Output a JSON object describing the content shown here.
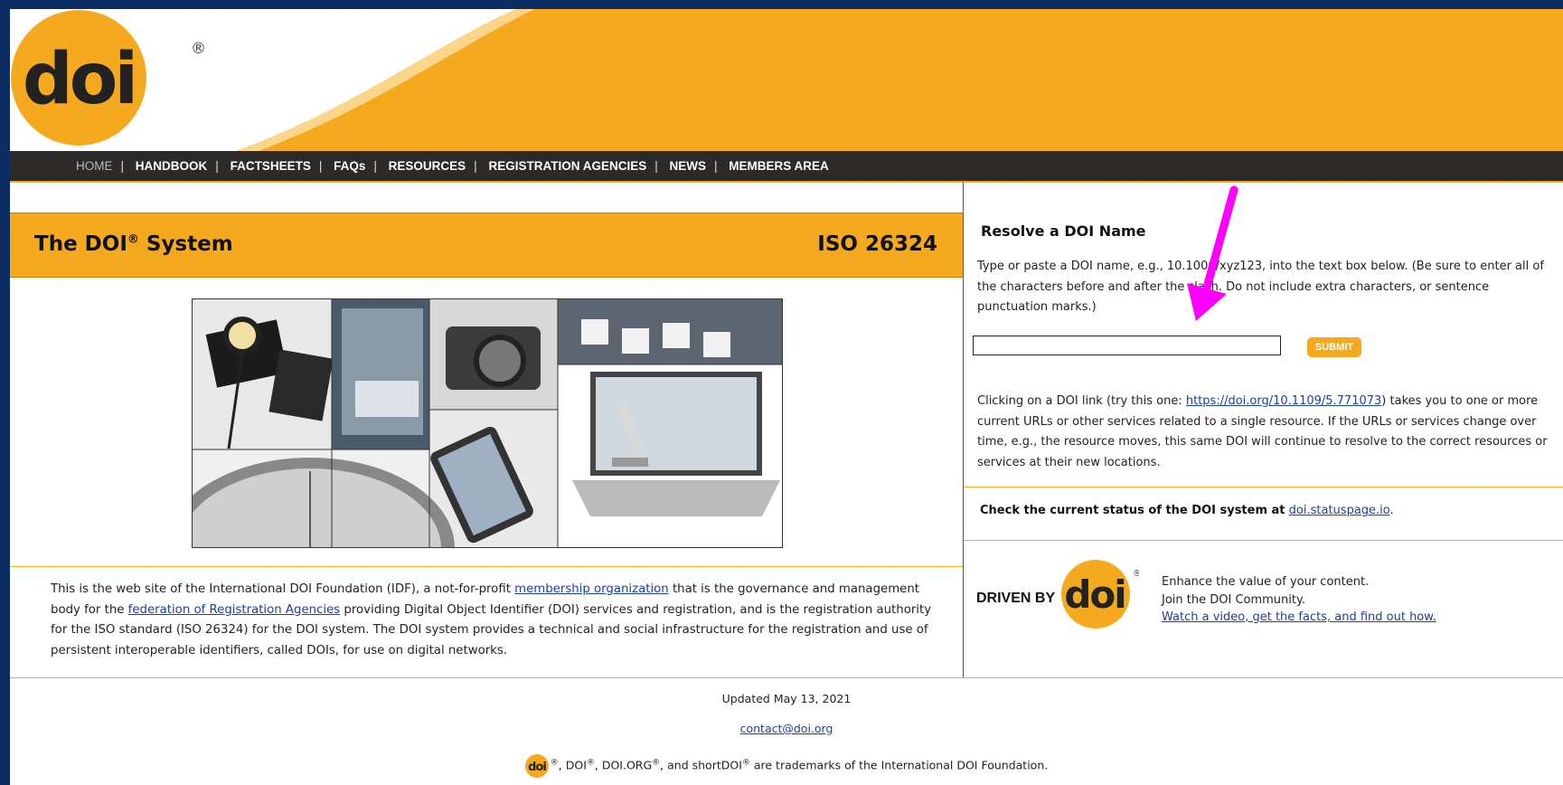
{
  "brand": {
    "logo_text": "doi",
    "registered": "®",
    "driven_by": "DRIVEN BY"
  },
  "colors": {
    "orange": "#f5a91f",
    "nav_bg": "#2c2b2a",
    "link": "#1a3fa8",
    "outer": "#0c2d64",
    "arrow": "#ff00ff"
  },
  "nav": {
    "items": [
      "HOME",
      "HANDBOOK",
      "FACTSHEETS",
      "FAQs",
      "RESOURCES",
      "REGISTRATION AGENCIES",
      "NEWS",
      "MEMBERS AREA"
    ],
    "separator": "|"
  },
  "main": {
    "title": "The DOI",
    "title_sup": "®",
    "title_suffix": " System",
    "iso": "ISO 26324",
    "intro_1": "This is the web site of the International DOI Foundation (IDF), a not-for-profit ",
    "intro_link_1": "membership organization",
    "intro_2": " that is the governance and management body for the ",
    "intro_link_2": "federation of Registration Agencies",
    "intro_3": " providing Digital Object Identifier (DOI) services and registration, and is the registration authority for the ISO standard (ISO 26324) for the DOI system. The DOI system provides a technical and social infrastructure for the registration and use of persistent interoperable identifiers, called DOIs, for use on digital networks."
  },
  "resolve": {
    "heading": "Resolve a DOI Name",
    "instructions": "Type or paste a DOI name, e.g., 10.1000/xyz123, into the text box below. (Be sure to enter all of the characters before and after the slash. Do not include extra characters, or sentence punctuation marks.)",
    "input_value": "",
    "submit_label": "SUBMIT",
    "click_1": "Clicking on a DOI link (try this one: ",
    "click_link": "https://doi.org/10.1109/5.771073",
    "click_2": ") takes you to one or more current URLs or other services related to a single resource. If the URLs or services change over time, e.g., the resource moves, this same DOI will continue to resolve to the correct resources or services at their new locations.",
    "status_bold": "Check the current status of the DOI system at",
    "status_link": "doi.statuspage.io",
    "status_end": ".",
    "enhance_1": "Enhance the value of your content.",
    "enhance_2": "Join the DOI Community.",
    "enhance_link": "Watch a video, get the facts, and find out how."
  },
  "footer": {
    "updated": "Updated May 13, 2021",
    "contact": "contact@doi.org",
    "tm_1": ", DOI",
    "tm_2": ", DOI.ORG",
    "tm_3": ", and shortDOI",
    "tm_4": " are trademarks of the International DOI Foundation.",
    "reg": "®"
  }
}
